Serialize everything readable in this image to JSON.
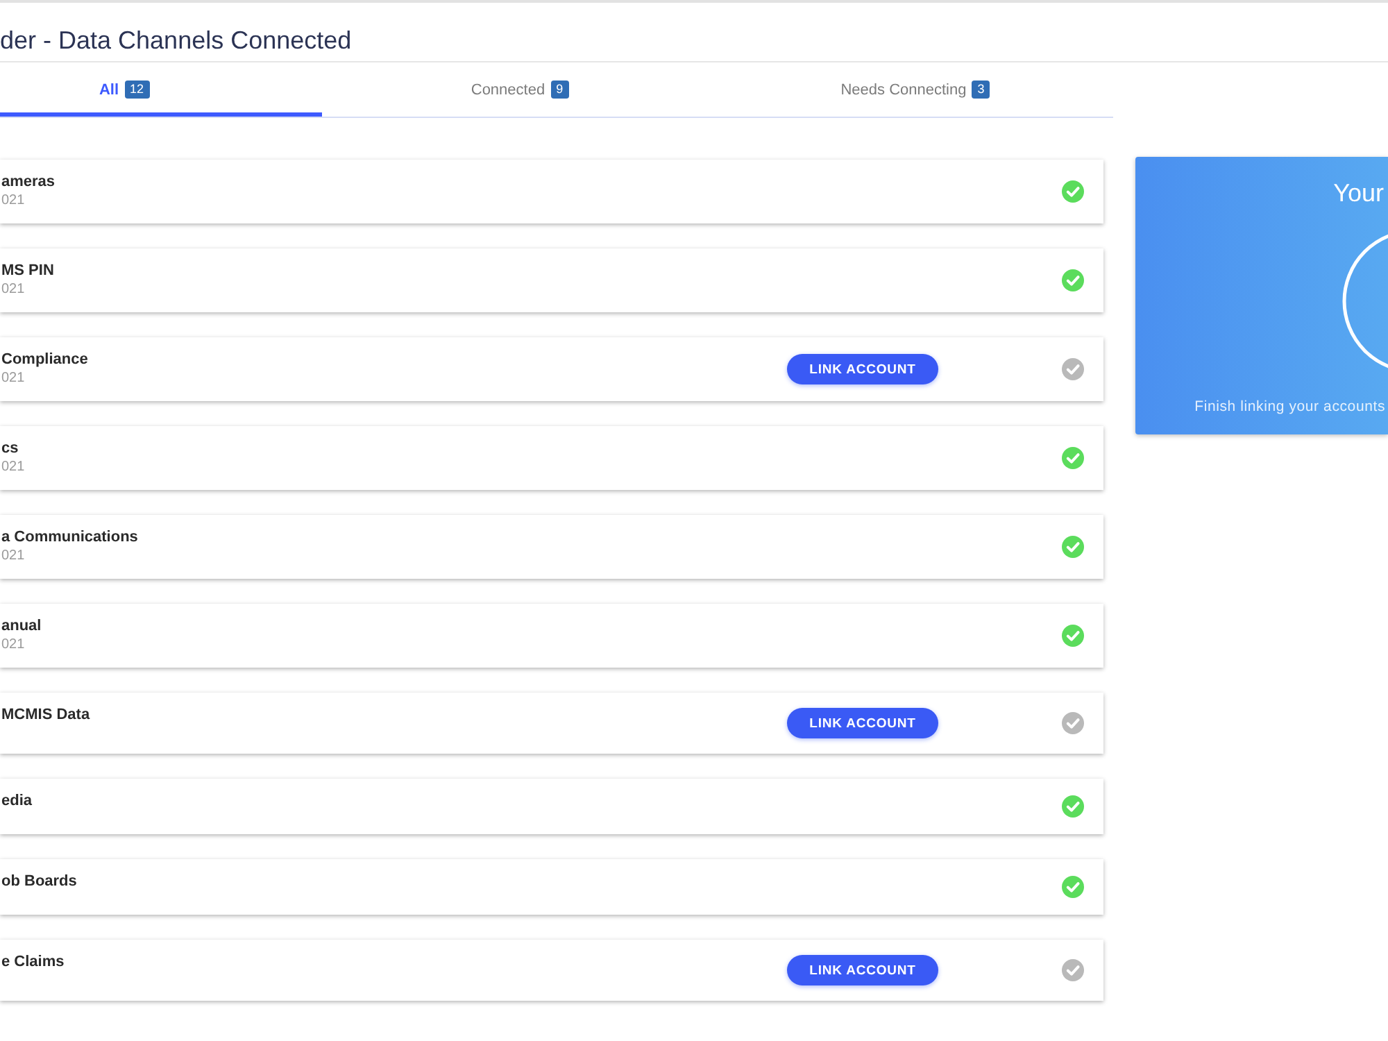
{
  "header": {
    "title": "der - Data Channels Connected"
  },
  "tabs": [
    {
      "label": "All",
      "count": "12",
      "selected": true
    },
    {
      "label": "Connected",
      "count": "9",
      "selected": false
    },
    {
      "label": "Needs Connecting",
      "count": "3",
      "selected": false
    }
  ],
  "channels": [
    {
      "name": "ameras",
      "date": "021",
      "connected": true
    },
    {
      "name": "MS PIN",
      "date": "021",
      "connected": true
    },
    {
      "name": "Compliance",
      "date": "021",
      "connected": false,
      "action": "LINK ACCOUNT"
    },
    {
      "name": "cs",
      "date": "021",
      "connected": true
    },
    {
      "name": "a Communications",
      "date": "021",
      "connected": true
    },
    {
      "name": "anual",
      "date": "021",
      "connected": true
    },
    {
      "name": "MCMIS Data",
      "connected": false,
      "action": "LINK ACCOUNT"
    },
    {
      "name": "edia",
      "connected": true
    },
    {
      "name": "ob Boards",
      "connected": true
    },
    {
      "name": "e Claims",
      "connected": false,
      "action": "LINK ACCOUNT"
    }
  ],
  "summary_card": {
    "title": "Your",
    "message": "Finish linking your accounts"
  }
}
